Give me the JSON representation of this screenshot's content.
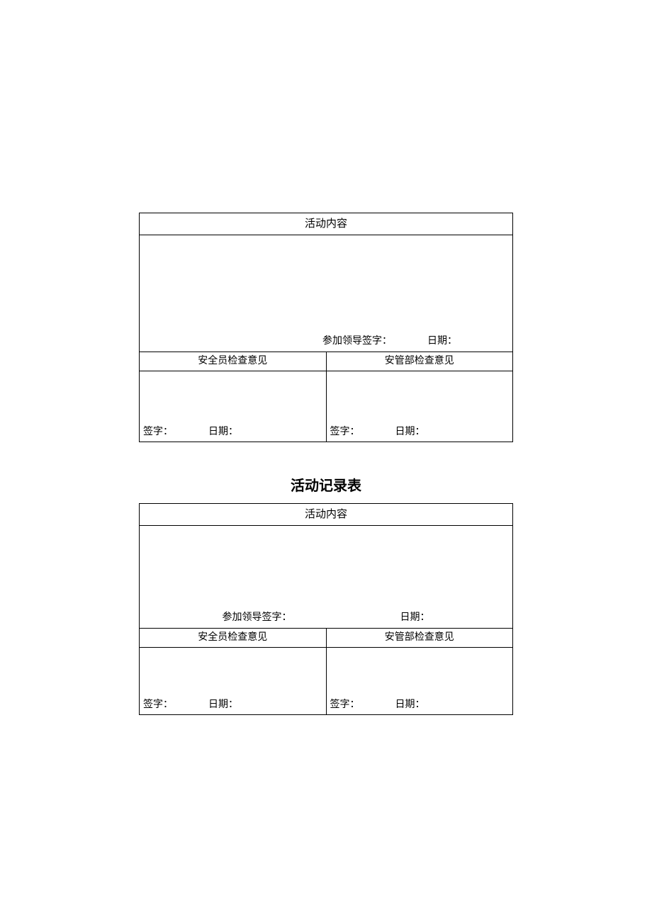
{
  "table1": {
    "header": "活动内容",
    "leader_sign_label": "参加领导签字：",
    "date_label": "日期：",
    "col1_header": "安全员检查意见",
    "col2_header": "安管部检查意见",
    "sign_label": "签字：",
    "date_label2": "日期："
  },
  "title": "活动记录表",
  "table2": {
    "header": "活动内容",
    "leader_sign_label": "参加领导签字：",
    "date_label": "日期：",
    "col1_header": "安全员检查意见",
    "col2_header": "安管部检查意见",
    "sign_label": "签字：",
    "date_label2": "日期："
  }
}
